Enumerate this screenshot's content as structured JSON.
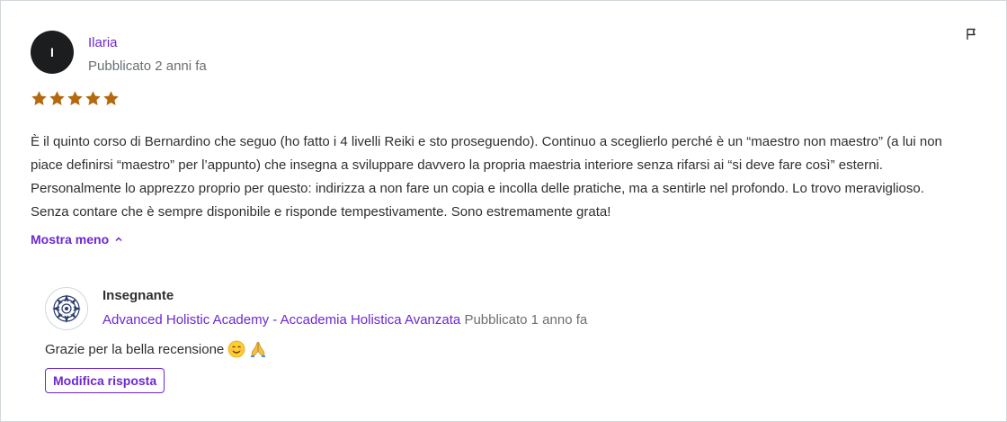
{
  "review": {
    "avatar_initial": "I",
    "author": "Ilaria",
    "published": "Pubblicato 2 anni fa",
    "rating": 5,
    "rating_max": 5,
    "text_lines": [
      "È il quinto corso di Bernardino che seguo (ho fatto i 4 livelli Reiki e sto proseguendo). Continuo a sceglierlo perché è un “maestro non maestro” (a lui non",
      "piace definirsi “maestro” per l’appunto) che insegna a sviluppare davvero la propria maestria interiore senza rifarsi ai “si deve fare così” esterni.",
      "Personalmente lo apprezzo proprio per questo: indirizza a non fare un copia e incolla delle pratiche, ma a sentirle nel profondo. Lo trovo meraviglioso.",
      "Senza contare che è sempre disponibile e risponde tempestivamente. Sono estremamente grata!"
    ],
    "toggle_label": "Mostra meno"
  },
  "reply": {
    "role": "Insegnante",
    "org": "Advanced Holistic Academy - Accademia Holistica Avanzata",
    "published": "Pubblicato 1 anno fa",
    "text": "Grazie per la bella recensione",
    "emojis": [
      "smiling-face-emoji",
      "folded-hands-emoji"
    ],
    "edit_label": "Modifica risposta"
  },
  "colors": {
    "accent": "#6d28d2",
    "star": "#b4690e",
    "text": "#2d2f31",
    "muted": "#6a6f73",
    "border": "#d1d7dc"
  }
}
